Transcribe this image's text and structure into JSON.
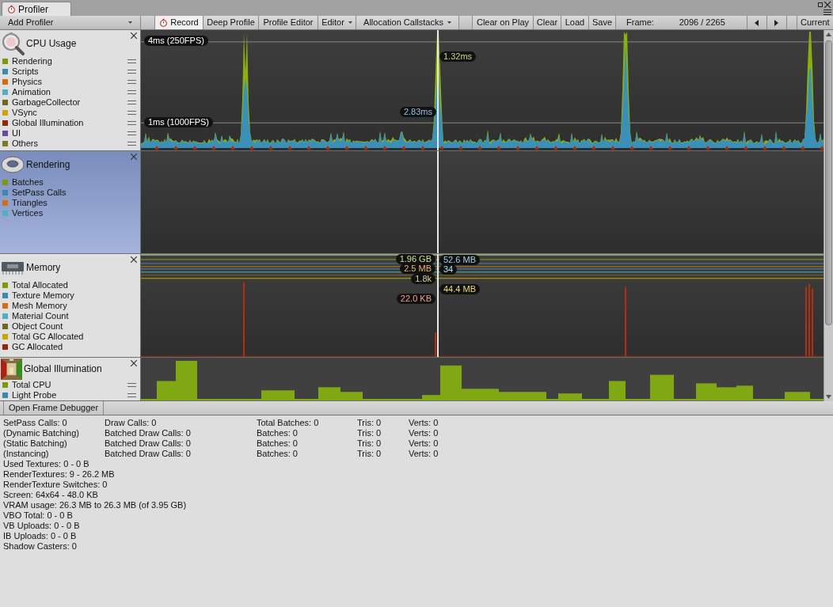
{
  "window": {
    "tab_title": "Profiler"
  },
  "toolbar": {
    "add_profiler": "Add Profiler",
    "buttons": [
      {
        "label": "Record",
        "kind": "toggle",
        "selected": true
      },
      {
        "label": "Deep Profile",
        "kind": "toggle",
        "selected": false
      },
      {
        "label": "Profile Editor",
        "kind": "toggle",
        "selected": false
      },
      {
        "label": "Editor",
        "kind": "dropdown",
        "selected": false
      },
      {
        "label": "Allocation Callstacks",
        "kind": "dropdown",
        "selected": false
      },
      {
        "label": "Clear on Play",
        "kind": "toggle",
        "selected": false
      },
      {
        "label": "Clear",
        "kind": "button",
        "selected": false
      },
      {
        "label": "Load",
        "kind": "button",
        "selected": false
      },
      {
        "label": "Save",
        "kind": "button",
        "selected": false
      }
    ],
    "frame_label": "Frame:",
    "frame_value": "2096 / 2265",
    "current": "Current"
  },
  "modules": [
    {
      "title": "CPU Usage",
      "kind": "cpu",
      "selected": false,
      "items": [
        {
          "name": "Rendering",
          "color": "#7a9a0a"
        },
        {
          "name": "Scripts",
          "color": "#3a8ab0"
        },
        {
          "name": "Physics",
          "color": "#d07010"
        },
        {
          "name": "Animation",
          "color": "#50b0c0"
        },
        {
          "name": "GarbageCollector",
          "color": "#706820"
        },
        {
          "name": "VSync",
          "color": "#c8a800"
        },
        {
          "name": "Global Illumination",
          "color": "#902810"
        },
        {
          "name": "UI",
          "color": "#6a4aa0"
        },
        {
          "name": "Others",
          "color": "#7a7a28"
        }
      ],
      "labels": [
        "4ms (250FPS)",
        "1ms (1000FPS)",
        "1.32ms",
        "2.83ms"
      ]
    },
    {
      "title": "Rendering",
      "kind": "rendering",
      "selected": true,
      "items": [
        {
          "name": "Batches",
          "color": "#7a9a0a"
        },
        {
          "name": "SetPass Calls",
          "color": "#3a8ab0"
        },
        {
          "name": "Triangles",
          "color": "#d07010"
        },
        {
          "name": "Vertices",
          "color": "#50b0c0"
        }
      ]
    },
    {
      "title": "Memory",
      "kind": "memory",
      "selected": false,
      "items": [
        {
          "name": "Total Allocated",
          "color": "#7a9a0a"
        },
        {
          "name": "Texture Memory",
          "color": "#3a8ab0"
        },
        {
          "name": "Mesh Memory",
          "color": "#d07010"
        },
        {
          "name": "Material Count",
          "color": "#50b0c0"
        },
        {
          "name": "Object Count",
          "color": "#706820"
        },
        {
          "name": "Total GC Allocated",
          "color": "#c8a800"
        },
        {
          "name": "GC Allocated",
          "color": "#902810"
        }
      ],
      "labels": [
        "1.96 GB",
        "52.6 MB",
        "2.5 MB",
        "34",
        "1.8k",
        "44.4 MB",
        "22.0 KB"
      ]
    },
    {
      "title": "Global Illumination",
      "kind": "gi",
      "selected": false,
      "items": [
        {
          "name": "Total CPU",
          "color": "#7a9a0a"
        },
        {
          "name": "Light Probe",
          "color": "#3a8ab0"
        }
      ]
    }
  ],
  "frame_debugger": "Open Frame Debugger",
  "stats": {
    "rows": [
      [
        "SetPass Calls: 0",
        "Draw Calls: 0",
        "Total Batches: 0",
        "Tris: 0",
        "Verts: 0"
      ],
      [
        "(Dynamic Batching)",
        "Batched Draw Calls: 0",
        "Batches: 0",
        "Tris: 0",
        "Verts: 0"
      ],
      [
        "(Static Batching)",
        "Batched Draw Calls: 0",
        "Batches: 0",
        "Tris: 0",
        "Verts: 0"
      ],
      [
        "(Instancing)",
        "Batched Draw Calls: 0",
        "Batches: 0",
        "Tris: 0",
        "Verts: 0"
      ]
    ],
    "lines": [
      "Used Textures: 0 - 0 B",
      "RenderTextures: 9 - 26.2 MB",
      "RenderTexture Switches: 0",
      "Screen: 64x64 - 48.0 KB",
      "VRAM usage: 26.3 MB to 26.3 MB (of 3.95 GB)",
      "VBO Total: 0 - 0 B",
      "VB Uploads: 0 - 0 B",
      "IB Uploads: 0 - 0 B",
      "Shadow Casters: 0"
    ]
  }
}
